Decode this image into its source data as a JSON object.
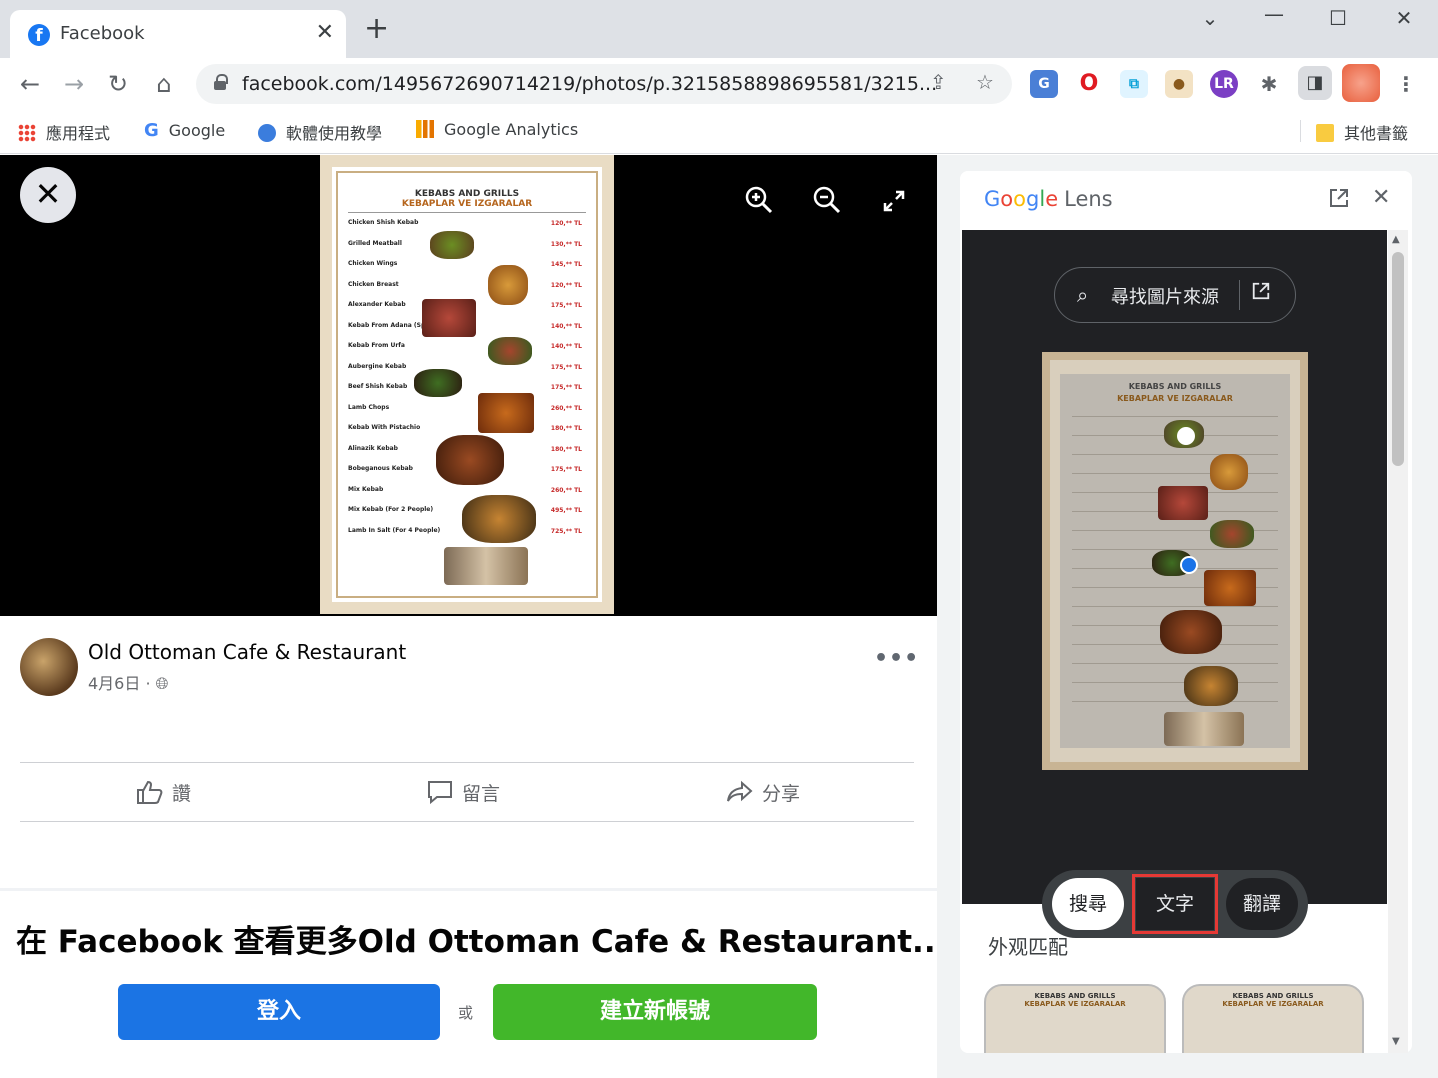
{
  "browser": {
    "tab_title": "Facebook",
    "tab_favicon": "f",
    "new_tab": "+",
    "url": "facebook.com/1495672690714219/photos/p.3215858898695581/3215...",
    "bookmarks": [
      {
        "label": "應用程式",
        "icon": "apps-grid-icon"
      },
      {
        "label": "Google",
        "icon": "google-g-icon"
      },
      {
        "label": "軟體使用教學",
        "icon": "software-icon"
      },
      {
        "label": "Google Analytics",
        "icon": "analytics-icon"
      },
      {
        "label": "其他書籤",
        "icon": "folder-icon"
      }
    ]
  },
  "viewer": {
    "menu": {
      "title": "KEBABS AND GRILLS",
      "subtitle": "KEBAPLAR VE IZGARALAR",
      "items": [
        {
          "name": "Chicken Shish Kebab",
          "price": "120,** TL"
        },
        {
          "name": "Grilled Meatball",
          "price": "130,** TL"
        },
        {
          "name": "Chicken Wings",
          "price": "145,** TL"
        },
        {
          "name": "Chicken Breast",
          "price": "120,** TL"
        },
        {
          "name": "Alexander Kebab",
          "price": "175,** TL"
        },
        {
          "name": "Kebab From Adana (Spicy)",
          "price": "140,** TL"
        },
        {
          "name": "Kebab From Urfa",
          "price": "140,** TL"
        },
        {
          "name": "Aubergine Kebab",
          "price": "175,** TL"
        },
        {
          "name": "Beef Shish Kebab",
          "price": "175,** TL"
        },
        {
          "name": "Lamb Chops",
          "price": "260,** TL"
        },
        {
          "name": "Kebab With Pistachio",
          "price": "180,** TL"
        },
        {
          "name": "Alinazik Kebab",
          "price": "180,** TL"
        },
        {
          "name": "Bobeganous Kebab",
          "price": "175,** TL"
        },
        {
          "name": "Mix Kebab",
          "price": "260,** TL"
        },
        {
          "name": "Mix Kebab (For 2 People)",
          "price": "495,** TL"
        },
        {
          "name": "Lamb In Salt (For 4 People)",
          "price": "725,** TL"
        }
      ]
    }
  },
  "post": {
    "page_name": "Old Ottoman Cafe & Restaurant",
    "meta": "4月6日 · ",
    "more": "•••",
    "like": "讚",
    "comment": "留言",
    "share": "分享",
    "promo": "在 Facebook 查看更多Old Ottoman Cafe & Restaurant...",
    "login": "登入",
    "or": "或",
    "create": "建立新帳號"
  },
  "lens": {
    "logo_letters": [
      "G",
      "o",
      "o",
      "g",
      "l",
      "e"
    ],
    "logo_word": "Lens",
    "find_source": "尋找圖片來源",
    "seg_search": "搜尋",
    "seg_text": "文字",
    "seg_translate": "翻譯",
    "match_label": "外观匹配",
    "thumb_title": "KEBABS AND GRILLS",
    "thumb_sub": "KEBAPLAR VE IZGARALAR"
  }
}
